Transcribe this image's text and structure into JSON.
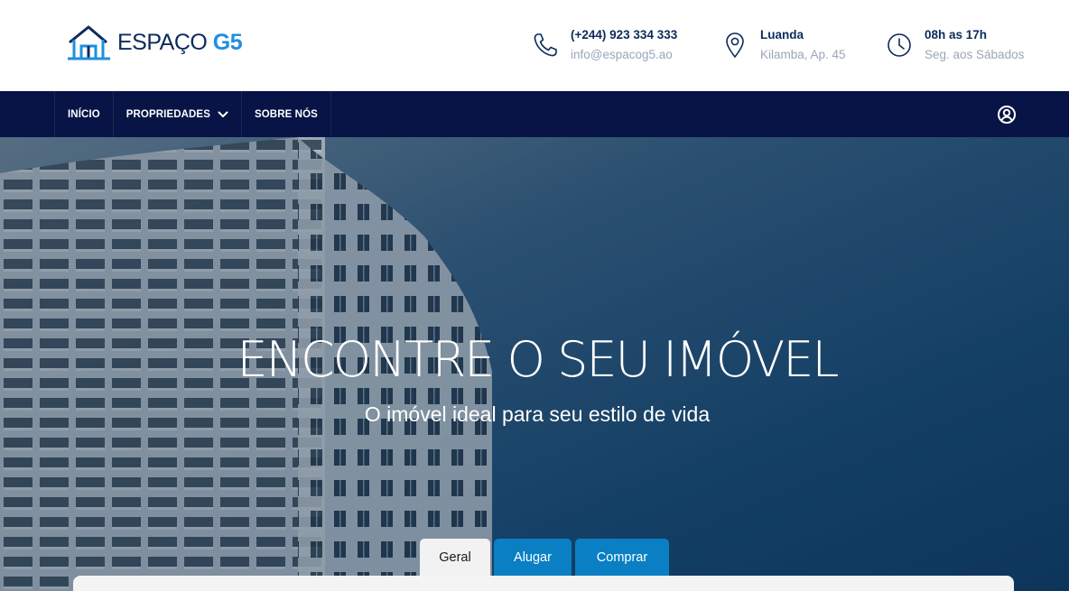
{
  "brand": {
    "name_main": "ESPAÇO",
    "name_accent": "G5",
    "logo_icon": "house-outline-icon",
    "colors": {
      "primary": "#0d2a5c",
      "accent": "#1f8fe0"
    }
  },
  "contacts": {
    "phone": {
      "icon": "phone-icon",
      "title": "(+244) 923 334 333",
      "subtitle": "info@espacog5.ao"
    },
    "location": {
      "icon": "map-pin-icon",
      "title": "Luanda",
      "subtitle": "Kilamba, Ap. 45"
    },
    "hours": {
      "icon": "clock-icon",
      "title": "08h as 17h",
      "subtitle": "Seg. aos Sábados"
    }
  },
  "nav": {
    "items": [
      {
        "label": "INÍCIO"
      },
      {
        "label": "PROPRIEDADES",
        "has_dropdown": true
      },
      {
        "label": "SOBRE NÓS"
      }
    ],
    "user_icon": "user-circle-icon",
    "background": "#071445"
  },
  "hero": {
    "title": "ENCONTRE O SEU IMÓVEL",
    "subtitle": "O imóvel ideal para seu estilo de vida"
  },
  "search": {
    "tabs": [
      {
        "label": "Geral",
        "active": true
      },
      {
        "label": "Alugar",
        "active": false
      },
      {
        "label": "Comprar",
        "active": false
      }
    ],
    "tab_color": "#0a7fc4"
  }
}
